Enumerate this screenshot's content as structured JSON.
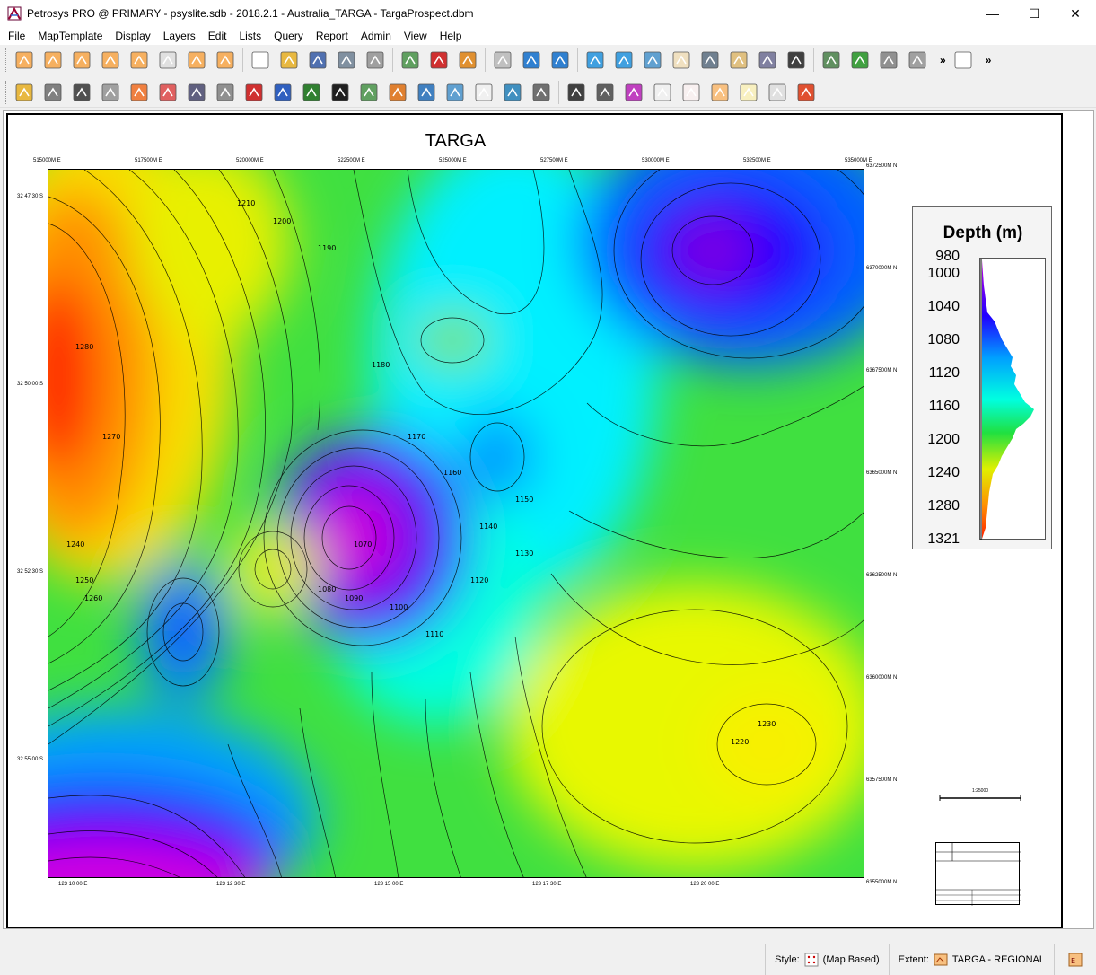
{
  "window": {
    "title": "Petrosys PRO @ PRIMARY - psyslite.sdb - 2018.2.1 - Australia_TARGA - TargaProspect.dbm",
    "minimize": "—",
    "maximize": "☐",
    "close": "✕"
  },
  "menu": [
    "File",
    "MapTemplate",
    "Display",
    "Layers",
    "Edit",
    "Lists",
    "Query",
    "Report",
    "Admin",
    "View",
    "Help"
  ],
  "toolbar1": {
    "icons": [
      "map-edit-icon",
      "map-zoom-icon",
      "map-plus10-icon",
      "map-plus100-icon",
      "map-pan-icon",
      "map-select-icon",
      "map-edit2-icon",
      "map-draw-icon",
      "new-file-icon",
      "open-folder-icon",
      "save-icon",
      "print-icon",
      "server-icon",
      "export-icon",
      "pdf-icon",
      "export-image-icon",
      "stop-icon",
      "undo-map-icon",
      "redo-map-icon",
      "zoom-in-icon",
      "zoom-out-icon",
      "zoom-extents-icon",
      "pan-hand-icon",
      "camera-icon",
      "clipboard-icon",
      "ruler-icon",
      "layer-icon",
      "list-icon",
      "undo-icon",
      "redo-icon",
      "settings-icon"
    ],
    "overflow": "»",
    "overflow2": "»"
  },
  "toolbar2": {
    "icons": [
      "add-layer-icon",
      "well-icon",
      "fault-icon",
      "grid-diamond-icon",
      "color-grid-icon",
      "color-mesh-icon",
      "grid-lines-icon",
      "contour-icon",
      "arrow-icon",
      "globe-icon",
      "table-icon",
      "e-icon",
      "polygon-icon",
      "pie-icon",
      "import-icon",
      "image-icon",
      "doc-icon",
      "layout-icon",
      "hash-icon",
      "north-arrow-icon",
      "scale-icon",
      "color-legend-icon",
      "text-block-icon",
      "dots-icon",
      "rect-icon",
      "points-icon",
      "panel-icon",
      "frame-icon"
    ]
  },
  "map": {
    "title": "TARGA",
    "top_x_labels": [
      "515000M E",
      "517500M E",
      "520000M E",
      "522500M E",
      "525000M E",
      "527500M E",
      "530000M E",
      "532500M E",
      "535000M E"
    ],
    "bottom_x_labels": [
      "123  10  00  E",
      "123  12  30  E",
      "123  15  00  E",
      "123  17  30  E",
      "123  20  00  E"
    ],
    "left_y_labels": [
      "32  47  30  S",
      "32  50  00  S",
      "32  52  30  S",
      "32  55  00  S"
    ],
    "right_y_labels": [
      "6372500M N",
      "6370000M N",
      "6367500M N",
      "6365000M N",
      "6362500M N",
      "6360000M N",
      "6357500M N",
      "6355000M N"
    ],
    "contour_labels": [
      "1210",
      "1200",
      "1190",
      "1180",
      "1170",
      "1160",
      "1150",
      "1140",
      "1130",
      "1120",
      "1110",
      "1100",
      "1090",
      "1080",
      "1070",
      "1220",
      "1230",
      "1240",
      "1250",
      "1260",
      "1270",
      "1280"
    ]
  },
  "legend": {
    "title": "Depth (m)",
    "ticks": [
      "980",
      "1000",
      "1040",
      "1080",
      "1120",
      "1160",
      "1200",
      "1240",
      "1280",
      "1321"
    ]
  },
  "scale": {
    "ratio": "1:25000"
  },
  "status": {
    "style_label": "Style:",
    "style_value": "(Map Based)",
    "extent_label": "Extent:",
    "extent_value": "TARGA - REGIONAL"
  },
  "colors": {
    "deep": "#e000e0",
    "blue": "#0020ff",
    "cyan": "#00e0ff",
    "green": "#20e040",
    "yellow": "#f0f000",
    "orange": "#ff9000",
    "red": "#ff2000"
  }
}
